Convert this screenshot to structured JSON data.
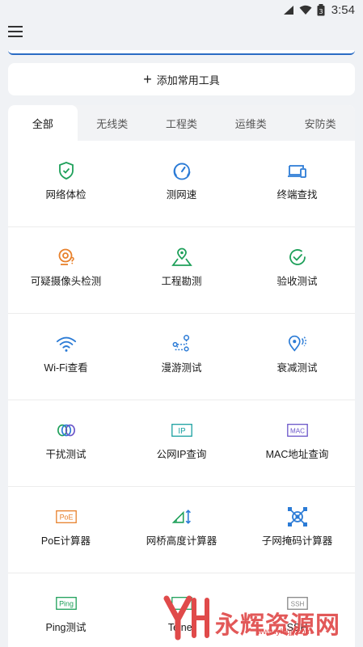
{
  "status_bar": {
    "time": "3:54",
    "battery_level": "3"
  },
  "add_tools": {
    "label": "添加常用工具"
  },
  "tabs": [
    "全部",
    "无线类",
    "工程类",
    "运维类",
    "安防类"
  ],
  "tools": [
    {
      "label": "网络体检",
      "icon": "shield-check-icon"
    },
    {
      "label": "测网速",
      "icon": "speedometer-icon"
    },
    {
      "label": "终端查找",
      "icon": "devices-icon"
    },
    {
      "label": "可疑摄像头检测",
      "icon": "camera-suspicious-icon"
    },
    {
      "label": "工程勘测",
      "icon": "map-pin-icon"
    },
    {
      "label": "验收测试",
      "icon": "check-circle-icon"
    },
    {
      "label": "Wi-Fi查看",
      "icon": "wifi-icon"
    },
    {
      "label": "漫游测试",
      "icon": "roaming-path-icon"
    },
    {
      "label": "衰减测试",
      "icon": "signal-location-icon"
    },
    {
      "label": "干扰测试",
      "icon": "interference-rings-icon"
    },
    {
      "label": "公网IP查询",
      "icon": "ip-badge-icon",
      "badge": "IP"
    },
    {
      "label": "MAC地址查询",
      "icon": "mac-badge-icon",
      "badge": "MAC"
    },
    {
      "label": "PoE计算器",
      "icon": "poe-badge-icon",
      "badge": "PoE"
    },
    {
      "label": "网桥高度计算器",
      "icon": "bridge-height-icon"
    },
    {
      "label": "子网掩码计算器",
      "icon": "subnet-icon"
    },
    {
      "label": "Ping测试",
      "icon": "ping-badge-icon",
      "badge": "Ping"
    },
    {
      "label": "Telnet",
      "icon": "telnet-icon"
    },
    {
      "label": "SSH",
      "icon": "ssh-badge-icon",
      "badge": "SSH"
    }
  ],
  "watermark": {
    "text": "永辉资源网",
    "url": "www.yhkjjj.com"
  },
  "colors": {
    "green": "#1ea05a",
    "blue": "#2b7bd6",
    "orange": "#e8812c",
    "purple": "#6a55c9",
    "accent": "#2b6cc4"
  }
}
